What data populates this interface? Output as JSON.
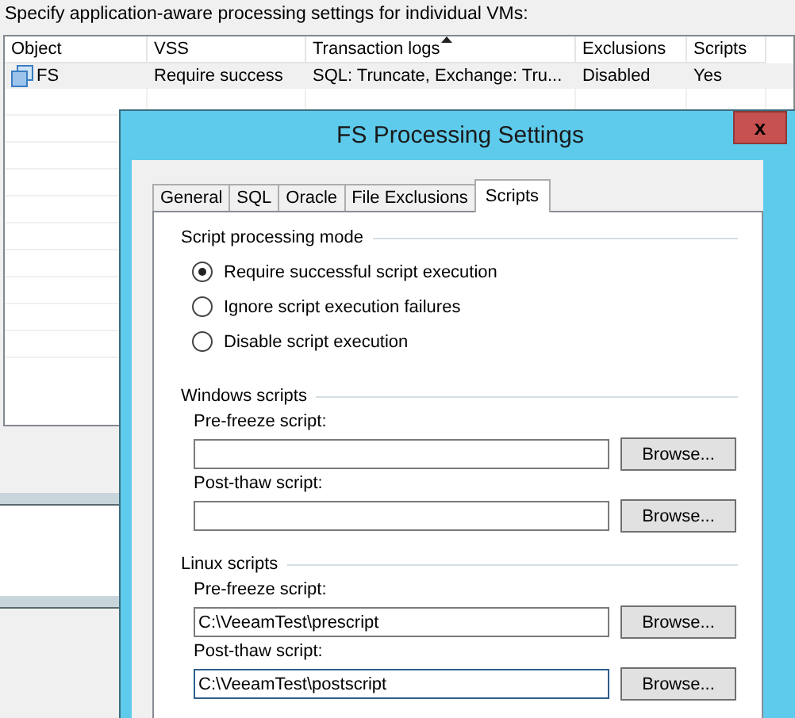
{
  "background": {
    "prompt": "Specify application-aware processing settings for individual VMs:",
    "table": {
      "columns": [
        {
          "label": "Object",
          "sorted": false
        },
        {
          "label": "VSS",
          "sorted": false
        },
        {
          "label": "Transaction logs",
          "sorted": true
        },
        {
          "label": "Exclusions",
          "sorted": false
        },
        {
          "label": "Scripts",
          "sorted": false
        }
      ],
      "rows": [
        {
          "selected": true,
          "cells": [
            "FS",
            "Require success",
            "SQL: Truncate, Exchange: Tru...",
            "Disabled",
            "Yes"
          ]
        }
      ]
    }
  },
  "dialog": {
    "title": "FS Processing Settings",
    "close": "x",
    "tabs": [
      {
        "label": "General",
        "selected": false
      },
      {
        "label": "SQL",
        "selected": false
      },
      {
        "label": "Oracle",
        "selected": false
      },
      {
        "label": "File Exclusions",
        "selected": false
      },
      {
        "label": "Scripts",
        "selected": true
      }
    ],
    "mode_group": {
      "title": "Script processing mode",
      "options": [
        {
          "label": "Require successful script execution",
          "selected": true
        },
        {
          "label": "Ignore script execution failures",
          "selected": false
        },
        {
          "label": "Disable script execution",
          "selected": false
        }
      ]
    },
    "script_groups": [
      {
        "title": "Windows scripts",
        "fields": [
          {
            "label": "Pre-freeze script:",
            "focused": false,
            "button": "Browse..."
          },
          {
            "label": "Post-thaw script:",
            "focused": false,
            "button": "Browse..."
          }
        ]
      },
      {
        "title": "Linux scripts",
        "fields": [
          {
            "label": "Pre-freeze script:",
            "value": "C:\\VeeamTest\\prescript",
            "focused": false,
            "button": "Browse..."
          },
          {
            "label": "Post-thaw script:",
            "value": "C:\\VeeamTest\\postscript",
            "focused": true,
            "button": "Browse..."
          }
        ]
      }
    ]
  }
}
